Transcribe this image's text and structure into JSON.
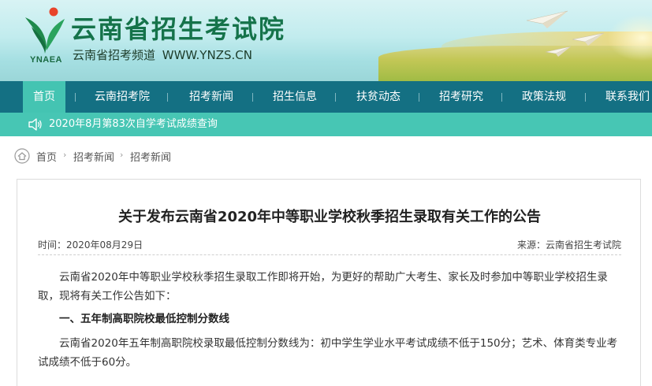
{
  "header": {
    "title": "云南省招生考试院",
    "abbr": "YNAEA",
    "subtitle": "云南省招考频道 WWW.YNZS.CN",
    "logo_icon": "leaf-logo-icon"
  },
  "nav": {
    "items": [
      {
        "label": "首页",
        "active": true
      },
      {
        "label": "云南招考院",
        "active": false
      },
      {
        "label": "招考新闻",
        "active": false
      },
      {
        "label": "招生信息",
        "active": false
      },
      {
        "label": "扶贫动态",
        "active": false
      },
      {
        "label": "招考研究",
        "active": false
      },
      {
        "label": "政策法规",
        "active": false
      },
      {
        "label": "联系我们",
        "active": false
      }
    ]
  },
  "notice": {
    "icon": "speaker-icon",
    "text": "2020年8月第83次自学考试成绩查询"
  },
  "breadcrumb": {
    "icon": "home-icon",
    "items": [
      "首页",
      "招考新闻",
      "招考新闻"
    ]
  },
  "article": {
    "title": "关于发布云南省2020年中等职业学校秋季招生录取有关工作的公告",
    "time": "时间：2020年08月29日",
    "source": "来源：云南省招生考试院",
    "paragraphs": [
      "云南省2020年中等职业学校秋季招生录取工作即将开始，为更好的帮助广大考生、家长及时参加中等职业学校招生录取，现将有关工作公告如下：",
      "一、五年制高职院校最低控制分数线",
      "云南省2020年五年制高职院校录取最低控制分数线为：初中学生学业水平考试成绩不低于150分；艺术、体育类专业考试成绩不低于60分。"
    ]
  },
  "colors": {
    "nav_bg": "#147083",
    "nav_active": "#44c4b2",
    "notice_bg": "#47c6b4",
    "brand_green": "#15734a"
  }
}
